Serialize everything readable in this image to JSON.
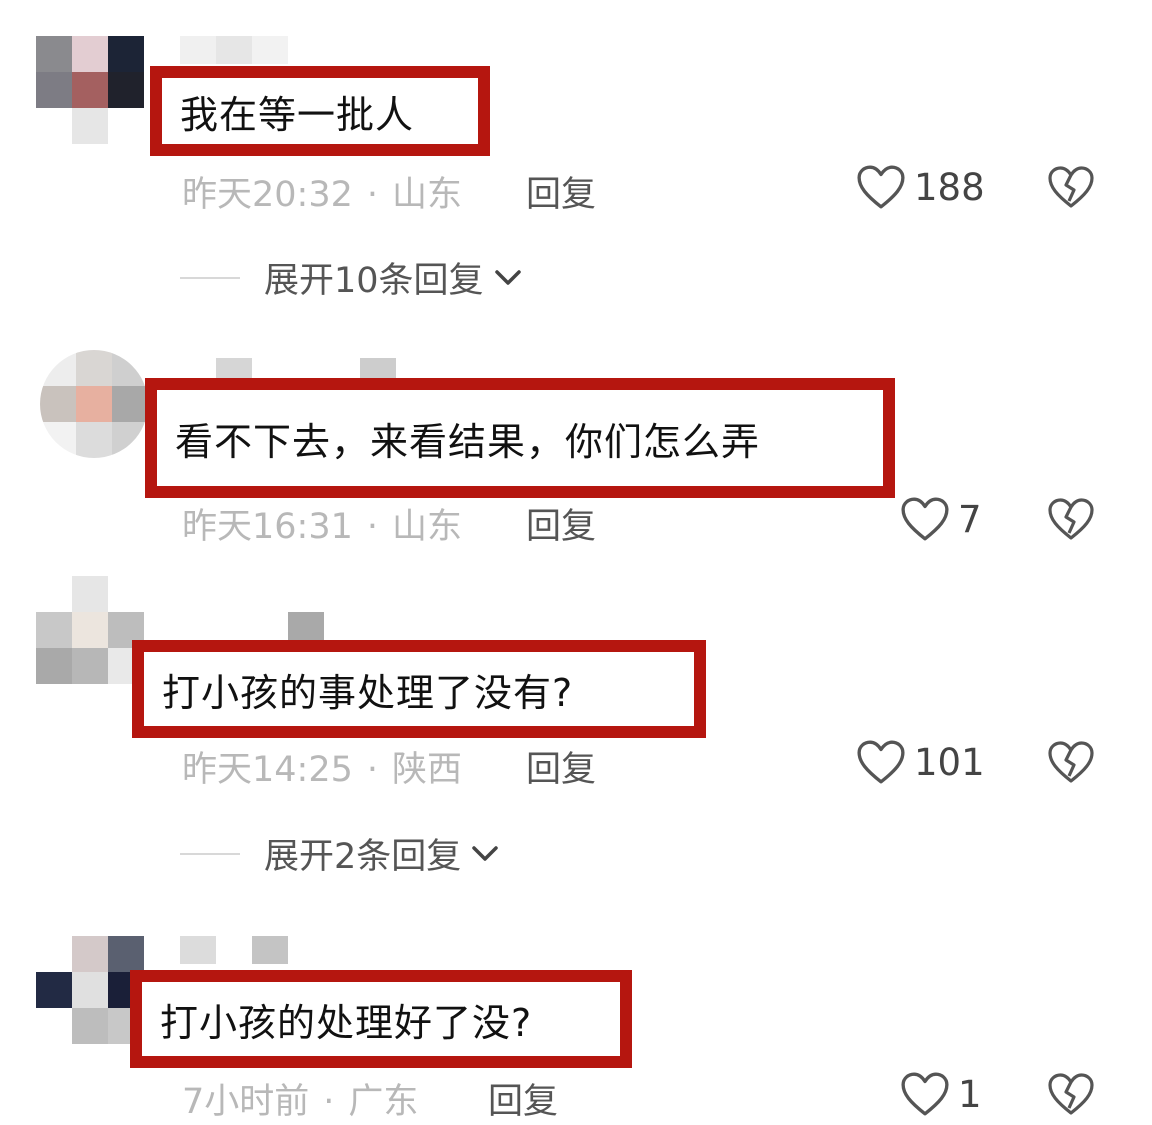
{
  "comments": [
    {
      "text": "我在等一批人",
      "time": "昨天20:32",
      "region": "山东",
      "reply": "回复",
      "likes": "188",
      "expand": "展开10条回复"
    },
    {
      "text": "看不下去，来看结果，你们怎么弄",
      "time": "昨天16:31",
      "region": "山东",
      "reply": "回复",
      "likes": "7"
    },
    {
      "text": "打小孩的事处理了没有?",
      "time": "昨天14:25",
      "region": "陕西",
      "reply": "回复",
      "likes": "101",
      "expand": "展开2条回复"
    },
    {
      "text": "打小孩的处理好了没?",
      "time": "7小时前",
      "region": "广东",
      "reply": "回复",
      "likes": "1"
    }
  ],
  "meta_separator": "·",
  "colors": {
    "highlight_border": "#b5160f",
    "meta_text": "#b8b8b8",
    "secondary_text": "#555555"
  },
  "icons": {
    "like": "heart-outline-icon",
    "dislike": "broken-heart-icon",
    "expand": "chevron-down-icon",
    "avatar": "pixelated-avatar"
  }
}
